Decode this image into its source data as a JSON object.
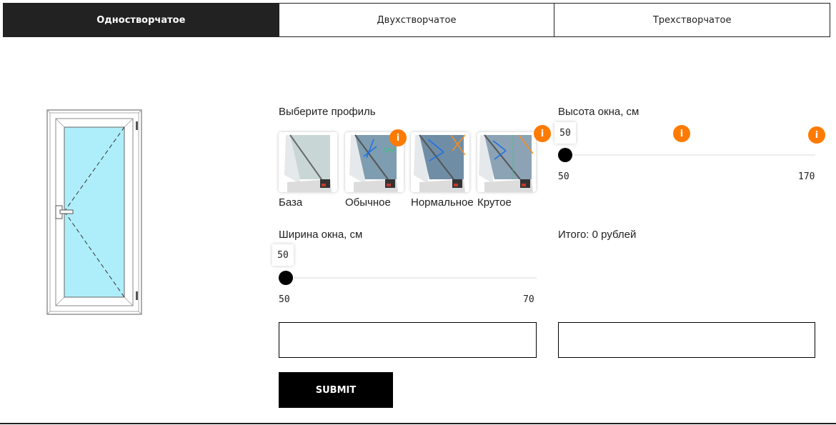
{
  "tabs": [
    {
      "label": "Одностворчатое",
      "active": true
    },
    {
      "label": "Двухстворчатое",
      "active": false
    },
    {
      "label": "Трехстворчатое",
      "active": false
    }
  ],
  "profile": {
    "title": "Выберите профиль",
    "items": [
      {
        "label": "База",
        "info": false
      },
      {
        "label": "Обычное",
        "info": true
      },
      {
        "label": "Нормальное",
        "info": true
      },
      {
        "label": "Крутое",
        "info": true
      }
    ],
    "info_glyph": "i"
  },
  "height": {
    "title": "Высота окна, см",
    "value": "50",
    "min": "50",
    "max": "170",
    "level": 0
  },
  "width": {
    "title": "Ширина окна, см",
    "value": "50",
    "min": "50",
    "max": "70",
    "level": 0
  },
  "total": {
    "label": "Итого: 0 рублей"
  },
  "inputs": {
    "left_value": "",
    "right_value": ""
  },
  "submit": {
    "label": "SUBMIT"
  },
  "colors": {
    "accent": "#ff7a00",
    "glass": "#aeeefa",
    "dark": "#222222"
  }
}
